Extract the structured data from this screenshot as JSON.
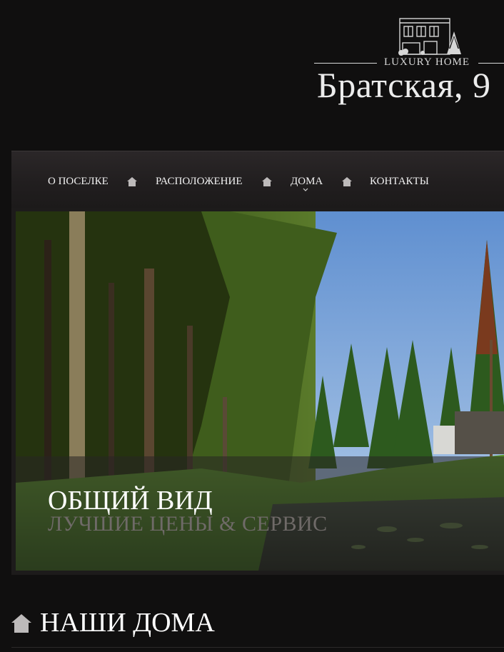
{
  "logo": {
    "tagline": "LUXURY HOME",
    "name": "Братская, 9"
  },
  "nav": {
    "items": [
      {
        "label": "О ПОСЕЛКЕ"
      },
      {
        "label": "РАСПОЛОЖЕНИЕ"
      },
      {
        "label": "ДОМА"
      },
      {
        "label": "КОНТАКТЫ"
      }
    ],
    "separator_icon": "house-icon",
    "dropdown_icon": "chevron-down-icon"
  },
  "slider": {
    "title": "ОБЩИЙ ВИД",
    "subtitle": "ЛУЧШИЕ ЦЕНЫ & СЕРВИС"
  },
  "section": {
    "title": "НАШИ ДОМА",
    "icon": "house-icon"
  },
  "colors": {
    "background": "#100f0f",
    "nav_background": "#262223",
    "text": "#ffffff",
    "subtitle": "#6f6a68"
  }
}
